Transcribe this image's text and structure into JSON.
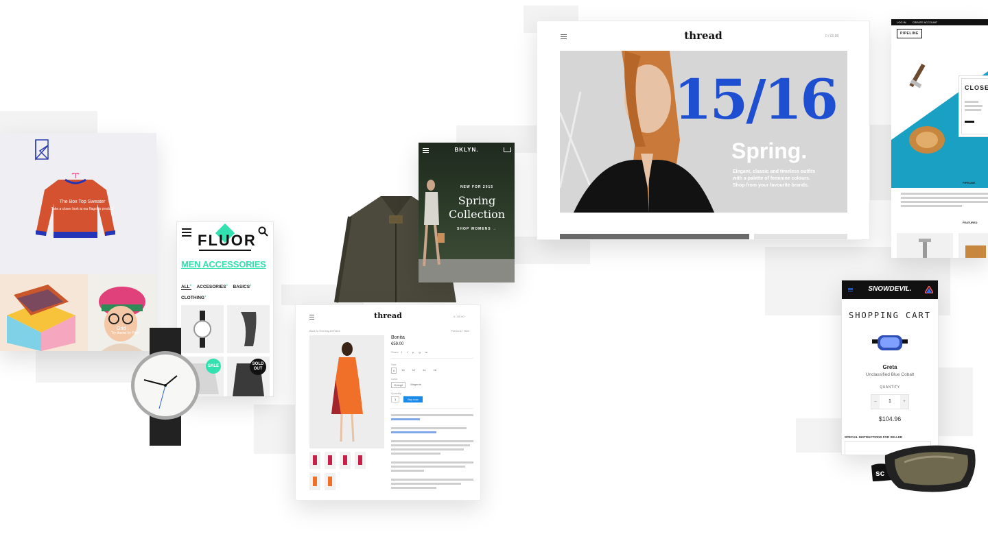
{
  "kaleido": {
    "product_caption_title": "The Box Top Sweater",
    "product_caption_sub": "Take a closer look at our flagship product",
    "tile2_label": "Grid",
    "tile2_sub": "Try theme by Pixel"
  },
  "fluor": {
    "logo": "FLUOR",
    "heading": "MEN ACCESSORIES",
    "filters": [
      "ALL",
      "ACCESORIES",
      "BASICS",
      "CLOTHING"
    ],
    "filter_counts": [
      "8",
      "4",
      "2",
      "4"
    ],
    "sale_badge": "SALE",
    "soldout_badge_line1": "SOLD",
    "soldout_badge_line2": "OUT"
  },
  "bklyn": {
    "logo": "BKLYN.",
    "eyebrow": "NEW FOR 2015",
    "headline_line1": "Spring",
    "headline_line2": "Collection",
    "cta": "SHOP WOMENS →"
  },
  "thread_hero": {
    "logo": "thread",
    "cart": "0 / £0.00",
    "big_number": "15/16",
    "season": "Spring.",
    "tagline_line1": "Elegant, classic and timeless outfits",
    "tagline_line2": "with a palette of feminine colours.",
    "tagline_line3": "Shop from your favourite brands."
  },
  "thread_product": {
    "logo": "thread",
    "cart": "0 / $0.00",
    "breadcrumb": "Back to Evening Dresses",
    "prev_next": "Previous / Next",
    "product_name": "Bonita",
    "price": "€59.00",
    "share_label": "Share",
    "size_label": "Size",
    "sizes": [
      "8",
      "10",
      "12",
      "14",
      "16"
    ],
    "color_label": "Color",
    "colors": [
      "Orange",
      "Magenta"
    ],
    "quantity_label": "Quantity",
    "quantity": "1",
    "buy_label": "Buy now"
  },
  "pipeline": {
    "topbar_links": [
      "LOG IN",
      "CREATE ACCOUNT"
    ],
    "logo": "PIPELINE",
    "card_title": "CLOSE",
    "section_label": "PIPELINE",
    "featured_label": "FEATURED"
  },
  "snowdevil": {
    "logo": "SNOWDEVIL.",
    "heading": "SHOPPING CART",
    "product_name": "Greta",
    "product_variant": "Unclassified Blue Cobalt",
    "quantity_label": "QUANTITY",
    "quantity": "1",
    "minus": "–",
    "plus": "+",
    "price": "$104.96",
    "instructions_label": "SPECIAL INSTRUCTIONS FOR SELLER"
  },
  "colors": {
    "fluor_accent": "#33e0b0",
    "thread_blue": "#1f4fd1",
    "pipeline_teal": "#1aa0c2",
    "snowdevil_black": "#111111",
    "product_orange": "#f0702a"
  }
}
